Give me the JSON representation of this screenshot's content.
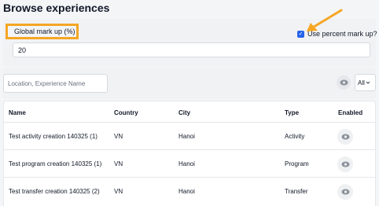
{
  "page": {
    "title": "Browse experiences"
  },
  "markup": {
    "label": "Global mark up (%)",
    "value": "20",
    "use_percent_label": "Use percent mark up?",
    "use_percent_checked": true,
    "highlight_color": "#f5a623"
  },
  "filters": {
    "search_placeholder": "Location, Experience Name",
    "enabled_filter": "All"
  },
  "table": {
    "columns": [
      "Name",
      "Country",
      "City",
      "Type",
      "Enabled"
    ],
    "rows": [
      {
        "name": "Test activity creation 140325 (1)",
        "country": "VN",
        "city": "Hanoi",
        "type": "Activity"
      },
      {
        "name": "Test program creation 140325 (1)",
        "country": "VN",
        "city": "Hanoi",
        "type": "Program"
      },
      {
        "name": "Test transfer creation 140325 (2)",
        "country": "VN",
        "city": "Hanoi",
        "type": "Transfer"
      }
    ]
  },
  "icons": {
    "enabled": "eye-icon",
    "dropdown": "chevron-down-icon",
    "checkbox": "checkmark-icon"
  }
}
